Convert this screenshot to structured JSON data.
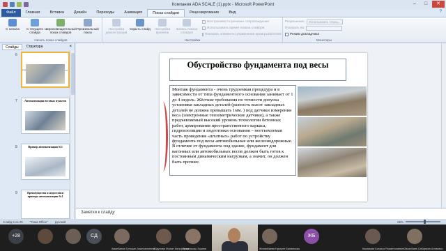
{
  "window": {
    "title": "Компания ADA SCALE (1).pptx - Microsoft PowerPoint"
  },
  "tabs": [
    "Файл",
    "Главная",
    "Вставка",
    "Дизайн",
    "Переходы",
    "Анимация",
    "Показ слайдов",
    "Рецензирование",
    "Вид"
  ],
  "ribbon": {
    "g1": {
      "caption": "Начать показ слайдов",
      "b1": "С начала",
      "b2": "С текущего слайда",
      "b3": "Широковещательный показ слайдов",
      "b4": "Произвольный показ"
    },
    "g2": {
      "caption": "Настройка",
      "b1": "Настройка демонстрации",
      "b2": "Скрыть слайд",
      "b3": "Настройка времени",
      "b4": "Запись показа слайдов",
      "c1": "Воспроизвести речевое сопровождение",
      "c2": "Использовать время показа слайдов",
      "c3": "Показать элементы управления проигрывателем"
    },
    "g3": {
      "caption": "Мониторы",
      "l1": "Разрешение:",
      "v1": "Использовать текущ...",
      "l2": "Показать на:",
      "v2": "",
      "c1": "Режим докладчика"
    }
  },
  "pane": {
    "tab_slides": "Слайды",
    "tab_outline": "Структура",
    "close": "×",
    "thumbs": [
      {
        "num": "6",
        "title": "Обустройство фундамента под весы"
      },
      {
        "num": "7",
        "title": "Автоматизация весовых пунктов"
      },
      {
        "num": "8",
        "title": "Пример автоматизации №1"
      },
      {
        "num": "9",
        "title": "Преимущества и недостатки примера автоматизации №1"
      }
    ]
  },
  "slide": {
    "title": "Обустройство фундамента под весы",
    "body": "Монтаж фундамента - очень трудоемкая процедура и в зависимости от типа фундаментного основания занимает от 1 до 4 недель. Жёсткие требования по точности допуска установки закладных деталей (разность высот закладных деталей не должна превышать 1мм. ) под датчики измерения веса (электронные тензометрические датчики), а также предъявляемый высокий уровень технологии бетонных работ, армирования пространственного каркаса, гидроизоляции и подготовки основания – неотъемлемая часть проведения «штатных» работ по устройству фундамента под весы автомобильные или железнодорожные. В отличие от фундамента под здание, фундамент для вагонных или автомобильных весов должен быть готов к постоянным динамическим нагрузкам, а значит, он должен быть прочнее."
  },
  "notes": {
    "placeholder": "Заметки к слайду"
  },
  "status": {
    "slide": "Слайд 6 из 25",
    "theme": "\"Тема Office\"",
    "lang": "русский",
    "zoom": "65%"
  },
  "meeting": {
    "participants": [
      {
        "initials": "+28",
        "name": "",
        "color": "#3b3f46"
      },
      {
        "initials": "",
        "name": "",
        "color": "#5d4a3c"
      },
      {
        "initials": "",
        "name": "",
        "color": "#6b5e55"
      },
      {
        "initials": "СД",
        "name": "",
        "color": "#4a4f58"
      },
      {
        "initials": "",
        "name": "Аманбаева Гульжан Амангалиевна",
        "color": "#7a6a60"
      },
      {
        "initials": "",
        "name": "Абдулова Жанат Каткоровна",
        "color": "#6e5a4d"
      },
      {
        "initials": "",
        "name": "Ержанкызы Зарина",
        "color": "#8a7466"
      },
      {
        "initials": "",
        "name": "Жилкибаева Нургуле Баланкызы",
        "color": "#77665b"
      },
      {
        "initials": "ЖБ",
        "name": "",
        "color": "#8b4fa7"
      },
      {
        "initials": "",
        "name": "Касимова Ботакоз Рахметолаевна",
        "color": "#6a5950"
      },
      {
        "initials": "",
        "name": "Тасанбаев Сабиржан Атлаевич",
        "color": "#80705f"
      }
    ]
  }
}
